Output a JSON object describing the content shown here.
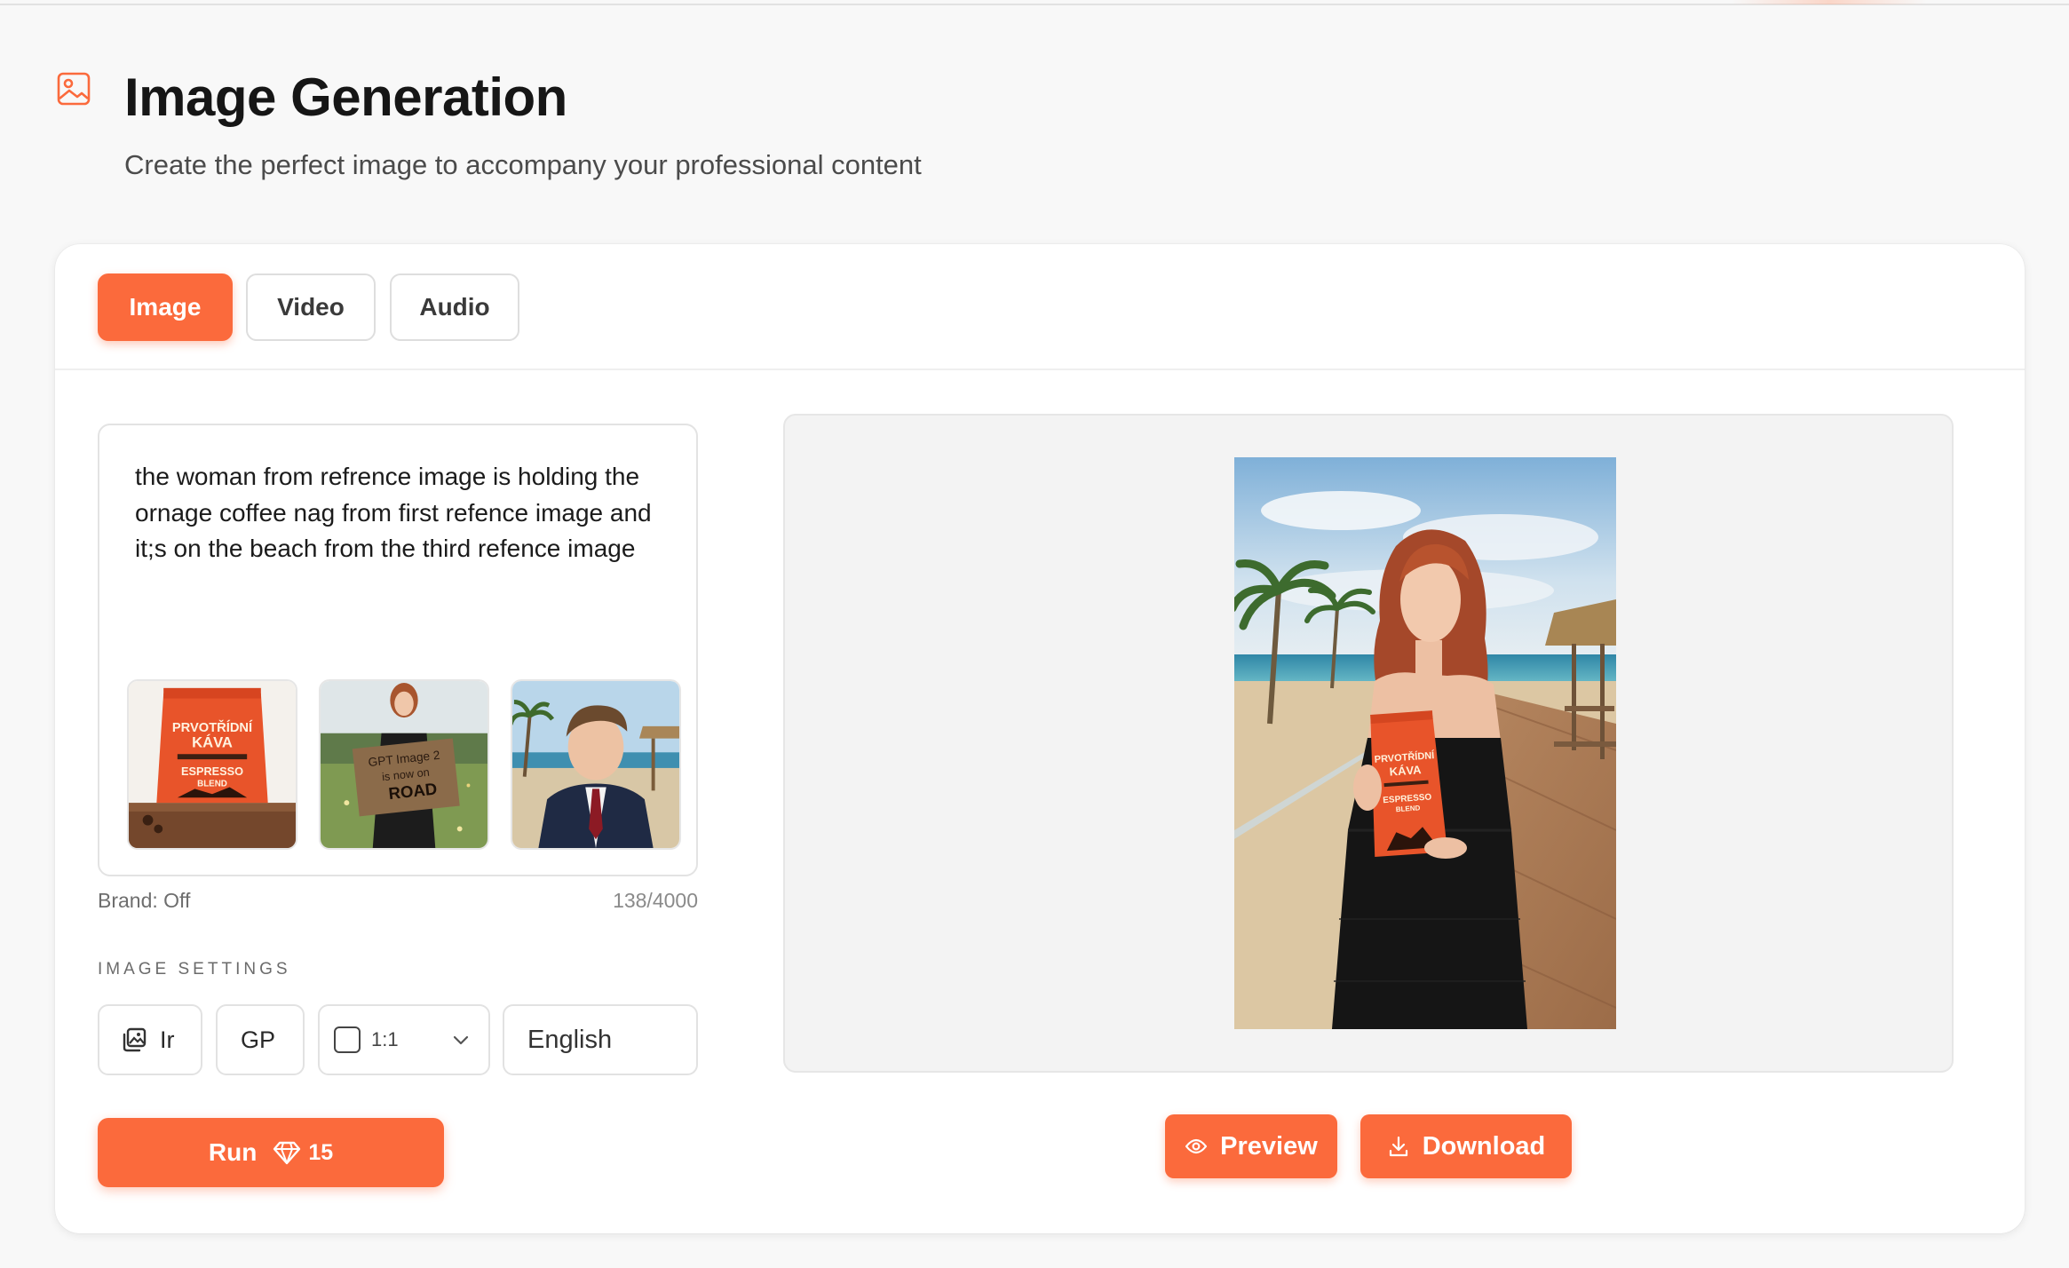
{
  "header": {
    "title": "Image Generation",
    "subtitle": "Create the perfect image to accompany your professional content",
    "icon": "image-icon",
    "accent_color": "#fb6a3c"
  },
  "tabs": [
    {
      "label": "Image",
      "active": true
    },
    {
      "label": "Video",
      "active": false
    },
    {
      "label": "Audio",
      "active": false
    }
  ],
  "prompt": {
    "text": "the woman from refrence image is holding the ornage coffee nag from first refence image and it;s on the beach from the third refence image",
    "brand_status": "Brand: Off",
    "char_count": "138/4000",
    "reference_images": [
      {
        "icon": "coffee-bag-thumbnail",
        "lines": [
          "PRVOTŘÍDNÍ",
          "KÁVA",
          "ESPRESSO",
          "BLEND"
        ]
      },
      {
        "icon": "woman-sign-thumbnail",
        "lines": [
          "GPT Image 2",
          "is now on",
          "ROAD"
        ]
      },
      {
        "icon": "beach-man-thumbnail"
      }
    ]
  },
  "settings": {
    "label": "IMAGE SETTINGS",
    "type_icon": "image-stack-icon",
    "type_value": "Ir",
    "model_value": "GP",
    "ratio_value": "1:1",
    "language_value": "English"
  },
  "run": {
    "label": "Run",
    "cost": "15",
    "cost_icon": "gem-icon"
  },
  "result": {
    "icon": "generated-image",
    "bag_lines": [
      "PRVOTŘÍDNÍ",
      "KÁVA",
      "ESPRESSO",
      "BLEND"
    ]
  },
  "actions": {
    "preview_label": "Preview",
    "download_label": "Download"
  }
}
